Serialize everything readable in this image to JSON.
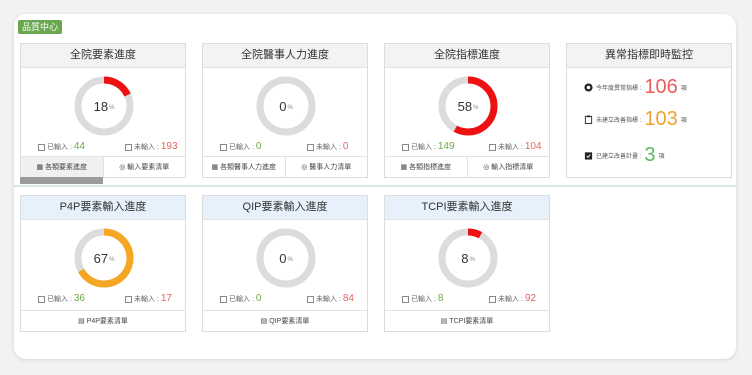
{
  "section_tag": "品質中心",
  "cards": [
    {
      "title": "全院要素進度",
      "percent": 18,
      "percent_unit": "%",
      "color": "#ee1111",
      "in_label": "已輸入 : ",
      "in_value": "44",
      "out_label": "未輸入 : ",
      "out_value": "193",
      "footer": [
        {
          "icon": "grid-icon",
          "label": "各類要素進度"
        },
        {
          "icon": "eye-icon",
          "label": "輸入要素清單"
        }
      ]
    },
    {
      "title": "全院醫事人力進度",
      "percent": 0,
      "percent_unit": "%",
      "color": "#ee1111",
      "in_label": "已輸入 : ",
      "in_value": "0",
      "out_label": "未輸入 : ",
      "out_value": "0",
      "footer": [
        {
          "icon": "grid-icon",
          "label": "各類醫事人力進度"
        },
        {
          "icon": "eye-icon",
          "label": "醫事人力清單"
        }
      ]
    },
    {
      "title": "全院指標進度",
      "percent": 58,
      "percent_unit": "%",
      "color": "#ee1111",
      "in_label": "已輸入 : ",
      "in_value": "149",
      "out_label": "未輸入 : ",
      "out_value": "104",
      "footer": [
        {
          "icon": "grid-icon",
          "label": "各類指標進度"
        },
        {
          "icon": "eye-icon",
          "label": "輸入指標清單"
        }
      ]
    },
    {
      "title": "P4P要素輸入進度",
      "percent": 67,
      "percent_unit": "%",
      "color": "#f5a623",
      "in_label": "已輸入 : ",
      "in_value": "36",
      "out_label": "未輸入 : ",
      "out_value": "17",
      "footer": [
        {
          "icon": "list-icon",
          "label": "P4P要素清單"
        }
      ]
    },
    {
      "title": "QIP要素輸入進度",
      "percent": 0,
      "percent_unit": "%",
      "color": "#ee1111",
      "in_label": "已輸入 : ",
      "in_value": "0",
      "out_label": "未輸入 : ",
      "out_value": "84",
      "footer": [
        {
          "icon": "list-icon",
          "label": "QIP要素清單"
        }
      ]
    },
    {
      "title": "TCPI要素輸入進度",
      "percent": 8,
      "percent_unit": "%",
      "color": "#ee1111",
      "in_label": "已輸入 : ",
      "in_value": "8",
      "out_label": "未輸入 : ",
      "out_value": "92",
      "footer": [
        {
          "icon": "list-icon",
          "label": "TCPI要素清單"
        }
      ]
    }
  ],
  "monitor": {
    "title": "異常指標即時監控",
    "rows": [
      {
        "icon": "alert-circle-icon",
        "label": "今年度異常指標 : ",
        "value": "106",
        "unit": "項",
        "color": "#e85c5c"
      },
      {
        "icon": "clipboard-icon",
        "label": "未建立改善指標 : ",
        "value": "103",
        "unit": "項",
        "color": "#f0a030"
      },
      {
        "icon": "clipboard-check-icon",
        "label": "已建立改善計畫 : ",
        "value": "3",
        "unit": "項",
        "color": "#5cb85c"
      }
    ]
  },
  "colors": {
    "track": "#dcdcdc",
    "green": "#6aa84f",
    "red": "#e06666"
  }
}
